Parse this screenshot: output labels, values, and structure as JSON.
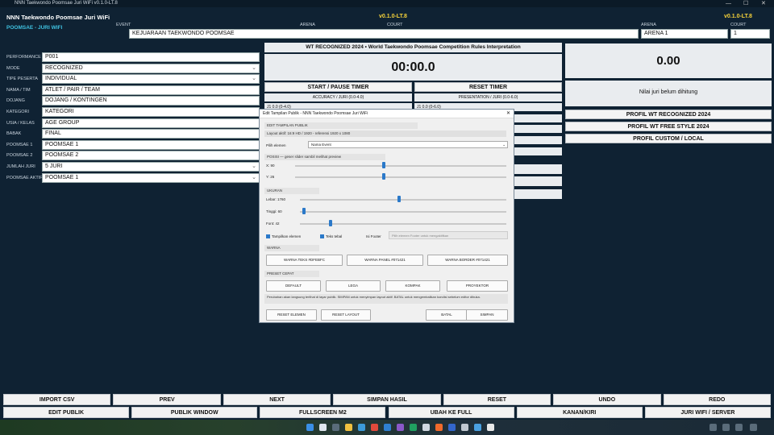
{
  "window": {
    "title": "NNN Taekwondo Poomsae Juri WiFi v0.1.0-LT.8"
  },
  "header": {
    "app_name": "NNN Taekwondo Poomsae Juri WiFi",
    "subtitle": "POOMSAE - JURI WIFI",
    "version_center": "v0.1.0-LT.8",
    "version_right": "v0.1.0-LT.8",
    "event_label": "EVENT",
    "arena_label": "ARENA",
    "court_label": "COURT",
    "arena_label_right": "ARENA",
    "court_label_right": "COURT",
    "event_value": "KEJUARAAN TAEKWONDO POOMSAE",
    "arena_value": "ARENA 1",
    "court_value": "1"
  },
  "form": {
    "fields": [
      {
        "label": "PERFORMANCE ID",
        "value": "P001",
        "dropdown": false
      },
      {
        "label": "MODE",
        "value": "RECOGNIZED",
        "dropdown": true
      },
      {
        "label": "TIPE PESERTA",
        "value": "INDIVIDUAL",
        "dropdown": true
      },
      {
        "label": "NAMA / TIM",
        "value": "ATLET / PAIR / TEAM",
        "dropdown": false
      },
      {
        "label": "DOJANG",
        "value": "DOJANG / KONTINGEN",
        "dropdown": false
      },
      {
        "label": "KATEGORI",
        "value": "KATEGORI",
        "dropdown": false
      },
      {
        "label": "USIA / KELAS",
        "value": "AGE GROUP",
        "dropdown": false
      },
      {
        "label": "BABAK",
        "value": "FINAL",
        "dropdown": false
      },
      {
        "label": "POOMSAE 1",
        "value": "POOMSAE 1",
        "dropdown": false
      },
      {
        "label": "POOMSAE 2",
        "value": "POOMSAE 2",
        "dropdown": false
      },
      {
        "label": "JUMLAH JURI",
        "value": "5 JURI",
        "dropdown": true
      },
      {
        "label": "POOMSAE AKTIF",
        "value": "POOMSAE 1",
        "dropdown": true
      }
    ]
  },
  "center": {
    "rules_title": "WT RECOGNIZED 2024 • World Taekwondo Poomsae Competition Rules Interpretation",
    "timer": "00:00.0",
    "start_pause": "START / PAUSE TIMER",
    "reset_timer": "RESET TIMER",
    "accuracy_label": "ACCURACY / JURI (0.0-4.0)",
    "presentation_label": "PRESENTATION / JURI (0.0-6.0)",
    "j1_acc": "J1 0.0 (0-4.0)",
    "j1_pres": "J1 0.0 (0-6.0)"
  },
  "right": {
    "score": "0.00",
    "score_note": "Nilai juri belum dihitung",
    "profiles": [
      "PROFIL WT RECOGNIZED 2024",
      "PROFIL WT FREE STYLE 2024",
      "PROFIL CUSTOM / LOCAL"
    ]
  },
  "dialog": {
    "title": "Edit Tampilan Publik - NNN Taekwondo Poomsae Juri WiFi",
    "close": "✕",
    "sec_edit": "EDIT TAMPILAN PUBLIK",
    "layout_info": "Layout aktif: 16:9 HD / 1920 - referensi 1920 x 1080",
    "pilih_label": "Pilih elemen",
    "pilih_value": "Nama Event",
    "sec_posisi": "POSISI — geser slider sambil melihat preview",
    "x_label": "X: 90",
    "y_label": "Y: 26",
    "x_pos": 0.42,
    "y_pos": 0.42,
    "sec_ukuran": "UKURAN",
    "lebar_label": "Lebar: 1760",
    "tinggi_label": "Tinggi: 60",
    "font_label": "Font: 42",
    "lebar_pos": 0.48,
    "tinggi_pos": 0.02,
    "font_pos": 0.15,
    "chk_tampil": "Tampilkan elemen",
    "chk_tebal": "Teks tebal",
    "isi_footer": "Isi Footer",
    "footer_hint": "Pilih elemen Footer untuk mengaktifkan",
    "sec_warna": "WARNA",
    "warna_teks": "WARNA TEKS #DFEBFC",
    "warna_panel": "WARNA PANEL #071421",
    "warna_border": "WARNA BORDER #071421",
    "sec_preset": "PRESET CEPAT",
    "preset": [
      "DEFAULT",
      "LEGA",
      "KOMPAK",
      "PROYEKTOR"
    ],
    "note": "Perubahan akan langsung terlihat di layar publik. SIMPAN untuk menyimpan layout aktif. BATAL untuk mengembalikan kondisi sebelum editor dibuka.",
    "reset_elemen": "RESET ELEMEN",
    "reset_layout": "RESET LAYOUT",
    "batal": "BATAL",
    "simpan": "SIMPAN"
  },
  "bottom_row1": [
    "IMPORT CSV",
    "PREV",
    "NEXT",
    "SIMPAN HASIL",
    "RESET",
    "UNDO",
    "REDO"
  ],
  "bottom_row2": [
    "EDIT PUBLIK",
    "PUBLIK WINDOW",
    "FULLSCREEN M2",
    "UBAH KE FULL",
    "KANAN/KIRI",
    "JURI WIFI / SERVER"
  ],
  "colors": {
    "bg": "#0f2233",
    "accent_yellow": "#f6d23a",
    "subtitle_cyan": "#3fc1e0",
    "slider_blue": "#2b79c9"
  }
}
